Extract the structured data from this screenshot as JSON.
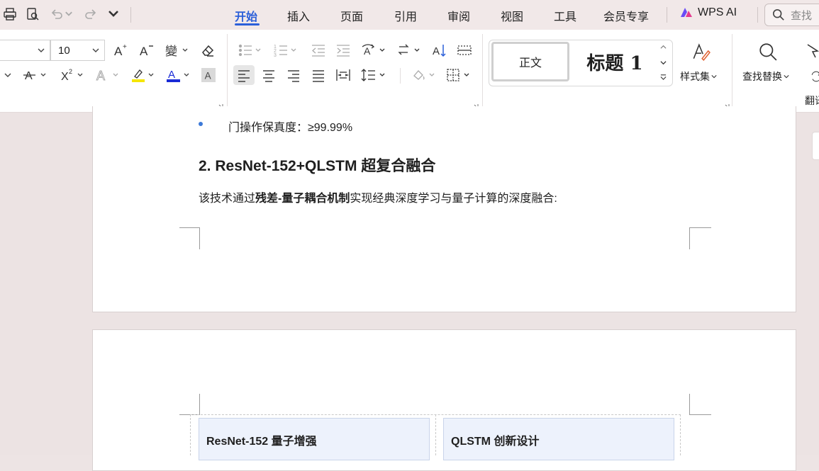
{
  "tabs": [
    {
      "label": "开始",
      "active": true
    },
    {
      "label": "插入"
    },
    {
      "label": "页面"
    },
    {
      "label": "引用"
    },
    {
      "label": "审阅"
    },
    {
      "label": "视图"
    },
    {
      "label": "工具"
    },
    {
      "label": "会员专享"
    }
  ],
  "wps_ai": {
    "label": "WPS AI",
    "icon": "wps-ai-logo-icon"
  },
  "search": {
    "placeholder": "查找"
  },
  "ribbon": {
    "font_size": "10",
    "styles": {
      "normal": "正文",
      "heading1": "标题 1"
    },
    "style_set_label": "样式集",
    "find_replace_label": "查找替换",
    "translate_label": "翻译"
  },
  "document": {
    "bullet_text": "门操作保真度：≥99.99%",
    "heading2": "2. ResNet-152+QLSTM 超复合融合",
    "para_prefix": "该技术通过",
    "para_bold": "残差-量子耦合机制",
    "para_suffix": "实现经典深度学习与量子计算的深度融合:",
    "table_cells": [
      {
        "title": "ResNet-152 量子增强"
      },
      {
        "title": "QLSTM 创新设计"
      }
    ]
  },
  "colors": {
    "accent": "#2b5fd9",
    "highlight_yellow": "#f5e600",
    "font_color_blue": "#1a2bd6",
    "cell_fill": "#edf2fc"
  }
}
